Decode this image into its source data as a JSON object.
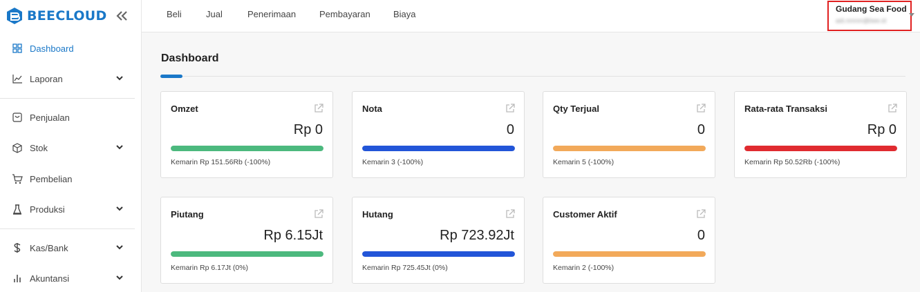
{
  "app": {
    "name": "BEECLOUD"
  },
  "sidebar": {
    "items": [
      {
        "label": "Dashboard",
        "icon": "dashboard-grid-icon",
        "active": true
      },
      {
        "label": "Laporan",
        "icon": "chart-line-icon",
        "expandable": true
      },
      {
        "label": "Penjualan",
        "icon": "sales-icon"
      },
      {
        "label": "Stok",
        "icon": "box-icon",
        "expandable": true
      },
      {
        "label": "Pembelian",
        "icon": "cart-icon"
      },
      {
        "label": "Produksi",
        "icon": "production-icon",
        "expandable": true
      },
      {
        "label": "Kas/Bank",
        "icon": "dollar-icon",
        "expandable": true
      },
      {
        "label": "Akuntansi",
        "icon": "bar-chart-icon",
        "expandable": true
      }
    ]
  },
  "topnav": {
    "items": [
      "Beli",
      "Jual",
      "Penerimaan",
      "Pembayaran",
      "Biaya"
    ]
  },
  "company": {
    "name": "Gudang Sea Food",
    "email": "adi.nmnm@bee.id"
  },
  "main": {
    "title": "Dashboard"
  },
  "cards": [
    {
      "title": "Omzet",
      "value": "Rp 0",
      "sub": "Kemarin Rp 151.56Rb (-100%)",
      "color": "#4cb97e",
      "fill": 1.0
    },
    {
      "title": "Nota",
      "value": "0",
      "sub": "Kemarin 3 (-100%)",
      "color": "#2255d8",
      "fill": 1.0
    },
    {
      "title": "Qty Terjual",
      "value": "0",
      "sub": "Kemarin 5 (-100%)",
      "color": "#f2a95a",
      "fill": 1.0
    },
    {
      "title": "Rata-rata Transaksi",
      "value": "Rp 0",
      "sub": "Kemarin Rp 50.52Rb (-100%)",
      "color": "#e02b30",
      "fill": 1.0
    },
    {
      "title": "Piutang",
      "value": "Rp 6.15Jt",
      "sub": "Kemarin Rp 6.17Jt (0%)",
      "color": "#4cb97e",
      "fill": 1.0
    },
    {
      "title": "Hutang",
      "value": "Rp 723.92Jt",
      "sub": "Kemarin Rp 725.45Jt (0%)",
      "color": "#2255d8",
      "fill": 1.0
    },
    {
      "title": "Customer Aktif",
      "value": "0",
      "sub": "Kemarin 2 (-100%)",
      "color": "#f2a95a",
      "fill": 1.0
    }
  ]
}
